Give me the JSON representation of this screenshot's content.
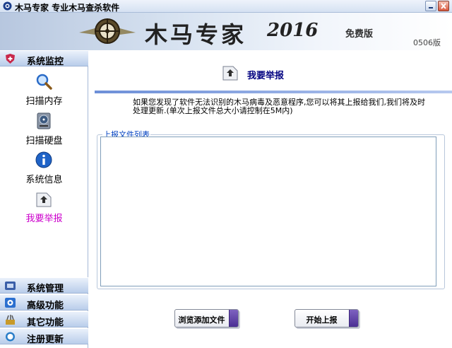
{
  "window": {
    "title": "木马专家  专业木马查杀软件"
  },
  "banner": {
    "title": "木马专家",
    "year": "2016",
    "edition": "免费版",
    "version": "0506版"
  },
  "sidebar": {
    "sections": [
      {
        "label": "系统监控",
        "icon": "shield-plus-icon",
        "color": "#c8284b"
      },
      {
        "label": "系统管理",
        "icon": "manage-icon",
        "color": "#3a5fa8"
      },
      {
        "label": "高级功能",
        "icon": "gear-icon",
        "color": "#2b6fcf"
      },
      {
        "label": "其它功能",
        "icon": "tools-icon",
        "color": "#c89a2a"
      },
      {
        "label": "注册更新",
        "icon": "register-icon",
        "color": "#2a7ec8"
      }
    ],
    "items": [
      {
        "label": "扫描内存",
        "icon": "magnifier-icon"
      },
      {
        "label": "扫描硬盘",
        "icon": "hard-disk-icon"
      },
      {
        "label": "系统信息",
        "icon": "info-icon"
      },
      {
        "label": "我要举报",
        "icon": "upload-report-icon",
        "active": true
      }
    ]
  },
  "main": {
    "title": "我要举报",
    "description": "如果您发现了软件无法识别的木马病毒及恶意程序,您可以将其上报给我们,我们将及时处理更新.(单次上报文件总大小请控制在5M内)",
    "group_label": "上报文件列表",
    "browse_button": "浏览添加文件",
    "upload_button": "开始上报"
  },
  "colors": {
    "accent": "#cc00cc",
    "title_blue": "#000080",
    "button_grip": "#4b2f94"
  }
}
